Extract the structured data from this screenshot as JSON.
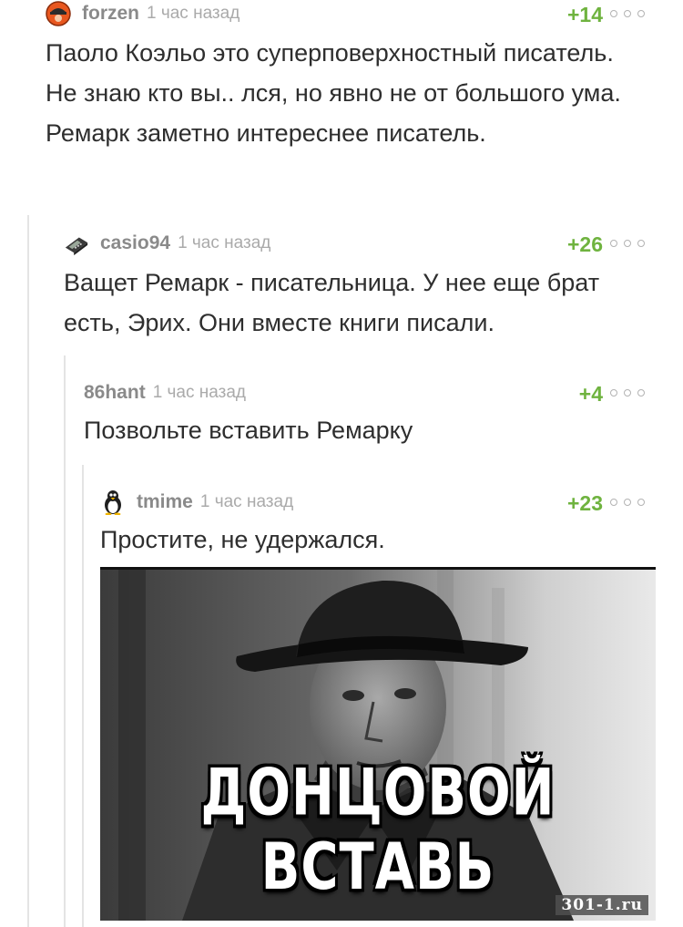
{
  "comments": [
    {
      "author": "forzen",
      "time": "1 час назад",
      "rating": "+14",
      "avatar_icon": "red-cap-avatar-icon",
      "text": "Паоло Коэльо это суперповерхностный писатель. Не знаю кто вы.. лся, но явно не от большого ума. Ремарк заметно интереснее писатель."
    },
    {
      "author": "casio94",
      "time": "1 час назад",
      "rating": "+26",
      "avatar_icon": "calculator-avatar-icon",
      "text": "Ващет Ремарк - писательница. У нее еще брат есть, Эрих. Они вместе книги писали."
    },
    {
      "author": "86hant",
      "time": "1 час назад",
      "rating": "+4",
      "avatar_icon": "",
      "text": "Позвольте вставить Ремарку"
    },
    {
      "author": "tmime",
      "time": "1 час назад",
      "rating": "+23",
      "avatar_icon": "penguin-avatar-icon",
      "text": "Простите, не удержался."
    }
  ],
  "image": {
    "caption": "ДОНЦОВОЙ ВСТАВЬ",
    "watermark": "301-1.ru"
  },
  "colors": {
    "rating": "#6fb33f",
    "author": "#8a8a8a",
    "time": "#aaaaaa",
    "thread_line": "#e4e4e4"
  }
}
